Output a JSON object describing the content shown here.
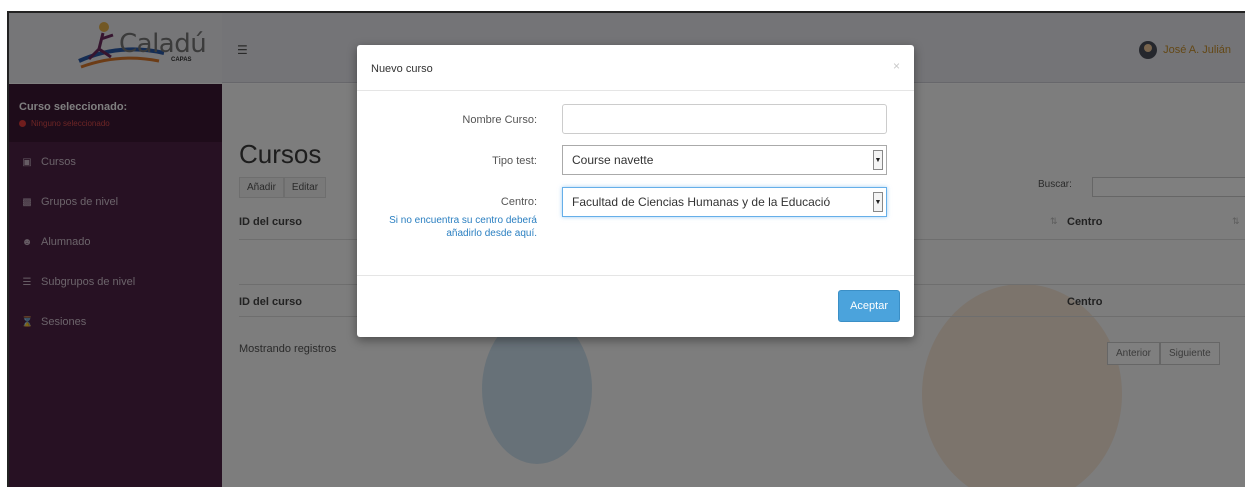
{
  "header": {
    "logo_text": "Caladú",
    "logo_sub": "CAPAS",
    "menu_icon": "hamburger-icon",
    "user_name": "José A. Julián"
  },
  "sidebar": {
    "selected_title": "Curso seleccionado:",
    "selected_status": "Ninguno seleccionado",
    "items": [
      {
        "label": "Cursos",
        "icon": "book-icon"
      },
      {
        "label": "Grupos de nivel",
        "icon": "bar-chart-icon"
      },
      {
        "label": "Alumnado",
        "icon": "users-icon"
      },
      {
        "label": "Subgrupos de nivel",
        "icon": "list-icon"
      },
      {
        "label": "Sesiones",
        "icon": "hourglass-icon"
      }
    ]
  },
  "main": {
    "title": "Cursos",
    "add_label": "Añadir",
    "edit_label": "Editar",
    "search_label": "Buscar:",
    "col_id": "ID del curso",
    "col_center": "Centro",
    "info": "Mostrando registros",
    "prev_label": "Anterior",
    "next_label": "Siguiente"
  },
  "modal": {
    "title": "Nuevo curso",
    "close_symbol": "×",
    "name_label": "Nombre Curso:",
    "name_value": "",
    "type_label": "Tipo test:",
    "type_value": "Course navette",
    "center_label": "Centro:",
    "center_value": "Facultad de Ciencias Humanas y de la Educació",
    "help_text": "Si no encuentra su centro deberá añadirlo desde aquí.",
    "accept_label": "Aceptar"
  },
  "colors": {
    "sidebar_bg": "#4e2346",
    "accent_blue": "#4ba3dc",
    "link_blue": "#2a7fc1",
    "user_gold": "#c8902c"
  }
}
